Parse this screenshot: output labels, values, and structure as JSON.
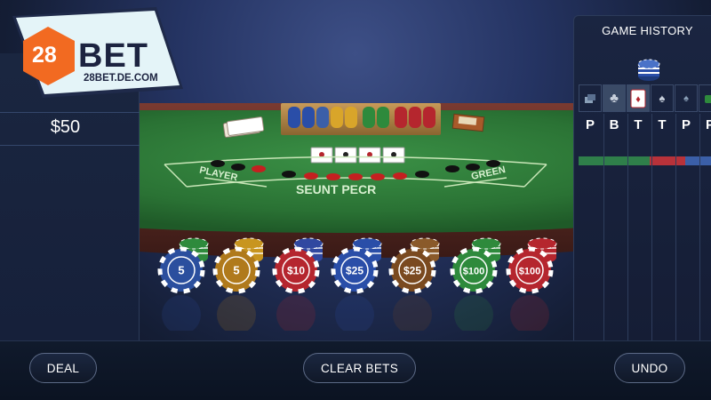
{
  "logo": {
    "number": "28",
    "brand": "BET",
    "url": "28BET.DE.COM",
    "orange": "#f26a21",
    "panel": "#dff2f8"
  },
  "left_panel": {
    "bet_amount": "$50"
  },
  "history": {
    "title": "GAME HISTORY",
    "columns": [
      {
        "icon": "small-chips-icon",
        "letter": "P"
      },
      {
        "icon": "club-icon",
        "letter": "B"
      },
      {
        "icon": "card-icon",
        "letter": "T"
      },
      {
        "icon": "spade-icon",
        "letter": "T"
      },
      {
        "icon": "spade-small-icon",
        "letter": "P"
      },
      {
        "icon": "green-chip-icon",
        "letter": "P"
      }
    ],
    "bar_colors": [
      "#2f7f4a",
      "#b8323a",
      "#3b5fa8"
    ]
  },
  "table": {
    "felt_labels": {
      "left": "PLAYER",
      "center": "SEUNT PECR",
      "right": "GREEN"
    },
    "felt_color": "#2f7d3a",
    "rail_color": "#5a2a24"
  },
  "chips": [
    {
      "label": "5",
      "color": "#2b4f9e",
      "stack": "#2e8a3c"
    },
    {
      "label": "5",
      "color": "#b07a1c",
      "stack": "#c8951f"
    },
    {
      "label": "$10",
      "color": "#b5262e",
      "stack": "#3048a0"
    },
    {
      "label": "$25",
      "color": "#2a4ea8",
      "stack": "#2a4ea8"
    },
    {
      "label": "$25",
      "color": "#7a4a20",
      "stack": "#8a5a2a"
    },
    {
      "label": "$100",
      "color": "#2e8a3c",
      "stack": "#2e8a3c"
    },
    {
      "label": "$100",
      "color": "#b5262e",
      "stack": "#b5262e"
    }
  ],
  "buttons": {
    "deal": "DEAL",
    "clear": "CLEAR BETS",
    "undo": "UNDO"
  }
}
